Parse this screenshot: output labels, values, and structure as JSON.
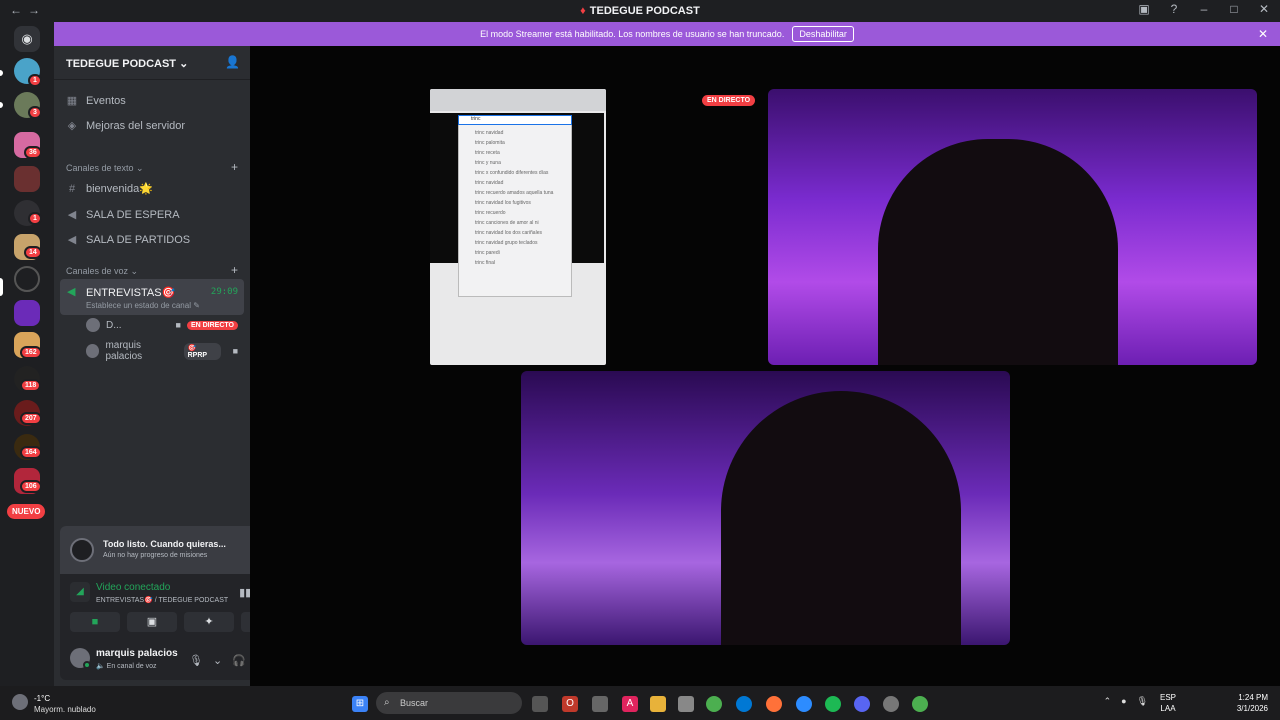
{
  "titlebar": {
    "title": "TEDEGUE PODCAST",
    "back": "←",
    "forward": "→"
  },
  "streamer_bar": {
    "message": "El modo Streamer está habilitado. Los nombres de usuario se han truncado.",
    "button": "Deshabilitar"
  },
  "servers": [
    {
      "badge": "1"
    },
    {
      "badge": "3"
    },
    {
      "badge": "36"
    },
    {
      "badge": ""
    },
    {
      "badge": "1"
    },
    {
      "badge": "14"
    },
    {
      "badge": ""
    },
    {
      "badge": ""
    },
    {
      "badge": "162"
    },
    {
      "badge": "118"
    },
    {
      "badge": "207"
    },
    {
      "badge": "164"
    },
    {
      "badge": "106"
    }
  ],
  "nuevo": "NUEVO",
  "server": {
    "name": "TEDEGUE PODCAST ⌄"
  },
  "nav_items": [
    {
      "label": "Eventos"
    },
    {
      "label": "Mejoras del servidor"
    }
  ],
  "categories": {
    "text": "Canales de texto ⌄",
    "voice": "Canales de voz ⌄"
  },
  "text_channels": [
    {
      "label": "bienvenida🌟"
    },
    {
      "label": "SALA DE ESPERA"
    },
    {
      "label": "SALA DE PARTIDOS"
    }
  ],
  "voice_channel": {
    "name": "ENTREVISTAS🎯",
    "timer": "29:09",
    "status": "Establece un estado de canal ✎"
  },
  "voice_users": [
    {
      "name": "D...",
      "badge": "EN DIRECTO"
    },
    {
      "name": "marquis palacios",
      "badge": "🎯 RPRP"
    }
  ],
  "quest": {
    "title": "Todo listo. Cuando quieras...",
    "subtitle": "Aún no hay progreso de misiones"
  },
  "voice_conn": {
    "status": "Video conectado",
    "channel": "ENTREVISTAS🎯 / TEDEGUE PODCAST"
  },
  "user": {
    "name": "marquis palacios",
    "status": "🔈 En canal de voz"
  },
  "stage": {
    "live_tag": "EN DIRECTO",
    "search_text": "trinc"
  },
  "search_suggestions": [
    "trinc navidad",
    "trinc palomita",
    "trinc receta",
    "trinc y nuna",
    "trinc x confundido diferentes días",
    "trinc navidad",
    "trinc recuerdo amados aquella tuna",
    "trinc navidad los fugitivos",
    "trinc recuerdo",
    "trinc canciones de amor al ni",
    "trinc navidad los dos cariñales",
    "trinc navidad grupo teclados",
    "trinc paredi",
    "trinc final"
  ],
  "taskbar": {
    "temp": "-1°C",
    "weather": "Mayorm. nublado",
    "search": "Buscar",
    "lang1": "ESP",
    "lang2": "LAA",
    "time": "1:24 PM",
    "date": "3/1/2026"
  },
  "colors": {
    "accent": "#9b59d9",
    "green": "#23a55a",
    "red": "#f23f43"
  }
}
